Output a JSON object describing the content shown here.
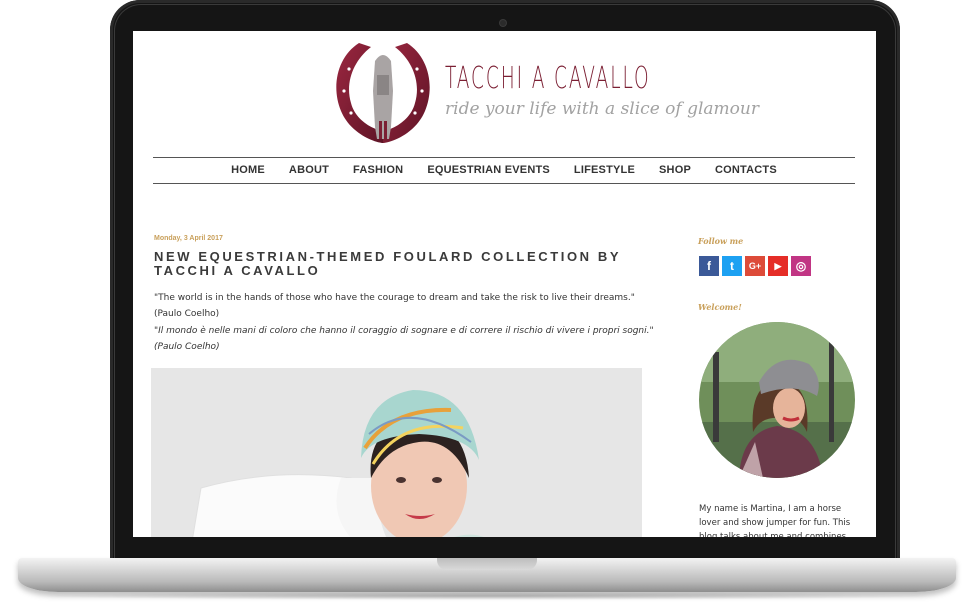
{
  "brand": {
    "title": "TACCHI A CAVALLO",
    "tagline": "ride your life with a slice of glamour",
    "accent": "#7b1f33"
  },
  "nav": {
    "items": [
      "HOME",
      "ABOUT",
      "FASHION",
      "EQUESTRIAN EVENTS",
      "LIFESTYLE",
      "SHOP",
      "CONTACTS"
    ]
  },
  "post": {
    "date": "Monday, 3 April 2017",
    "title": "NEW EQUESTRIAN-THEMED FOULARD COLLECTION BY TACCHI A CAVALLO",
    "quote_en": "\"The world is in the hands of those who have the courage to dream and take the risk to live their dreams.\"",
    "author_en": "(Paulo Coelho)",
    "quote_it": "\"Il mondo è nelle mani di coloro che hanno il coraggio di sognare e di correre il rischio di vivere i propri sogni.\"",
    "author_it": "(Paulo Coelho)"
  },
  "sidebar": {
    "follow_heading": "Follow me",
    "social": [
      {
        "icon": "facebook-icon",
        "glyph": "f",
        "color": "#3b5998"
      },
      {
        "icon": "twitter-icon",
        "glyph": "t",
        "color": "#1da1f2"
      },
      {
        "icon": "google-plus-icon",
        "glyph": "G+",
        "color": "#dd4b39"
      },
      {
        "icon": "youtube-icon",
        "glyph": "▶",
        "color": "#e52d27"
      },
      {
        "icon": "instagram-icon",
        "glyph": "◎",
        "color": "#c13584"
      }
    ],
    "welcome_heading": "Welcome!",
    "about_text": "My name is Martina, I am a horse lover and show jumper for fun. This blog talks about me and combines my"
  }
}
